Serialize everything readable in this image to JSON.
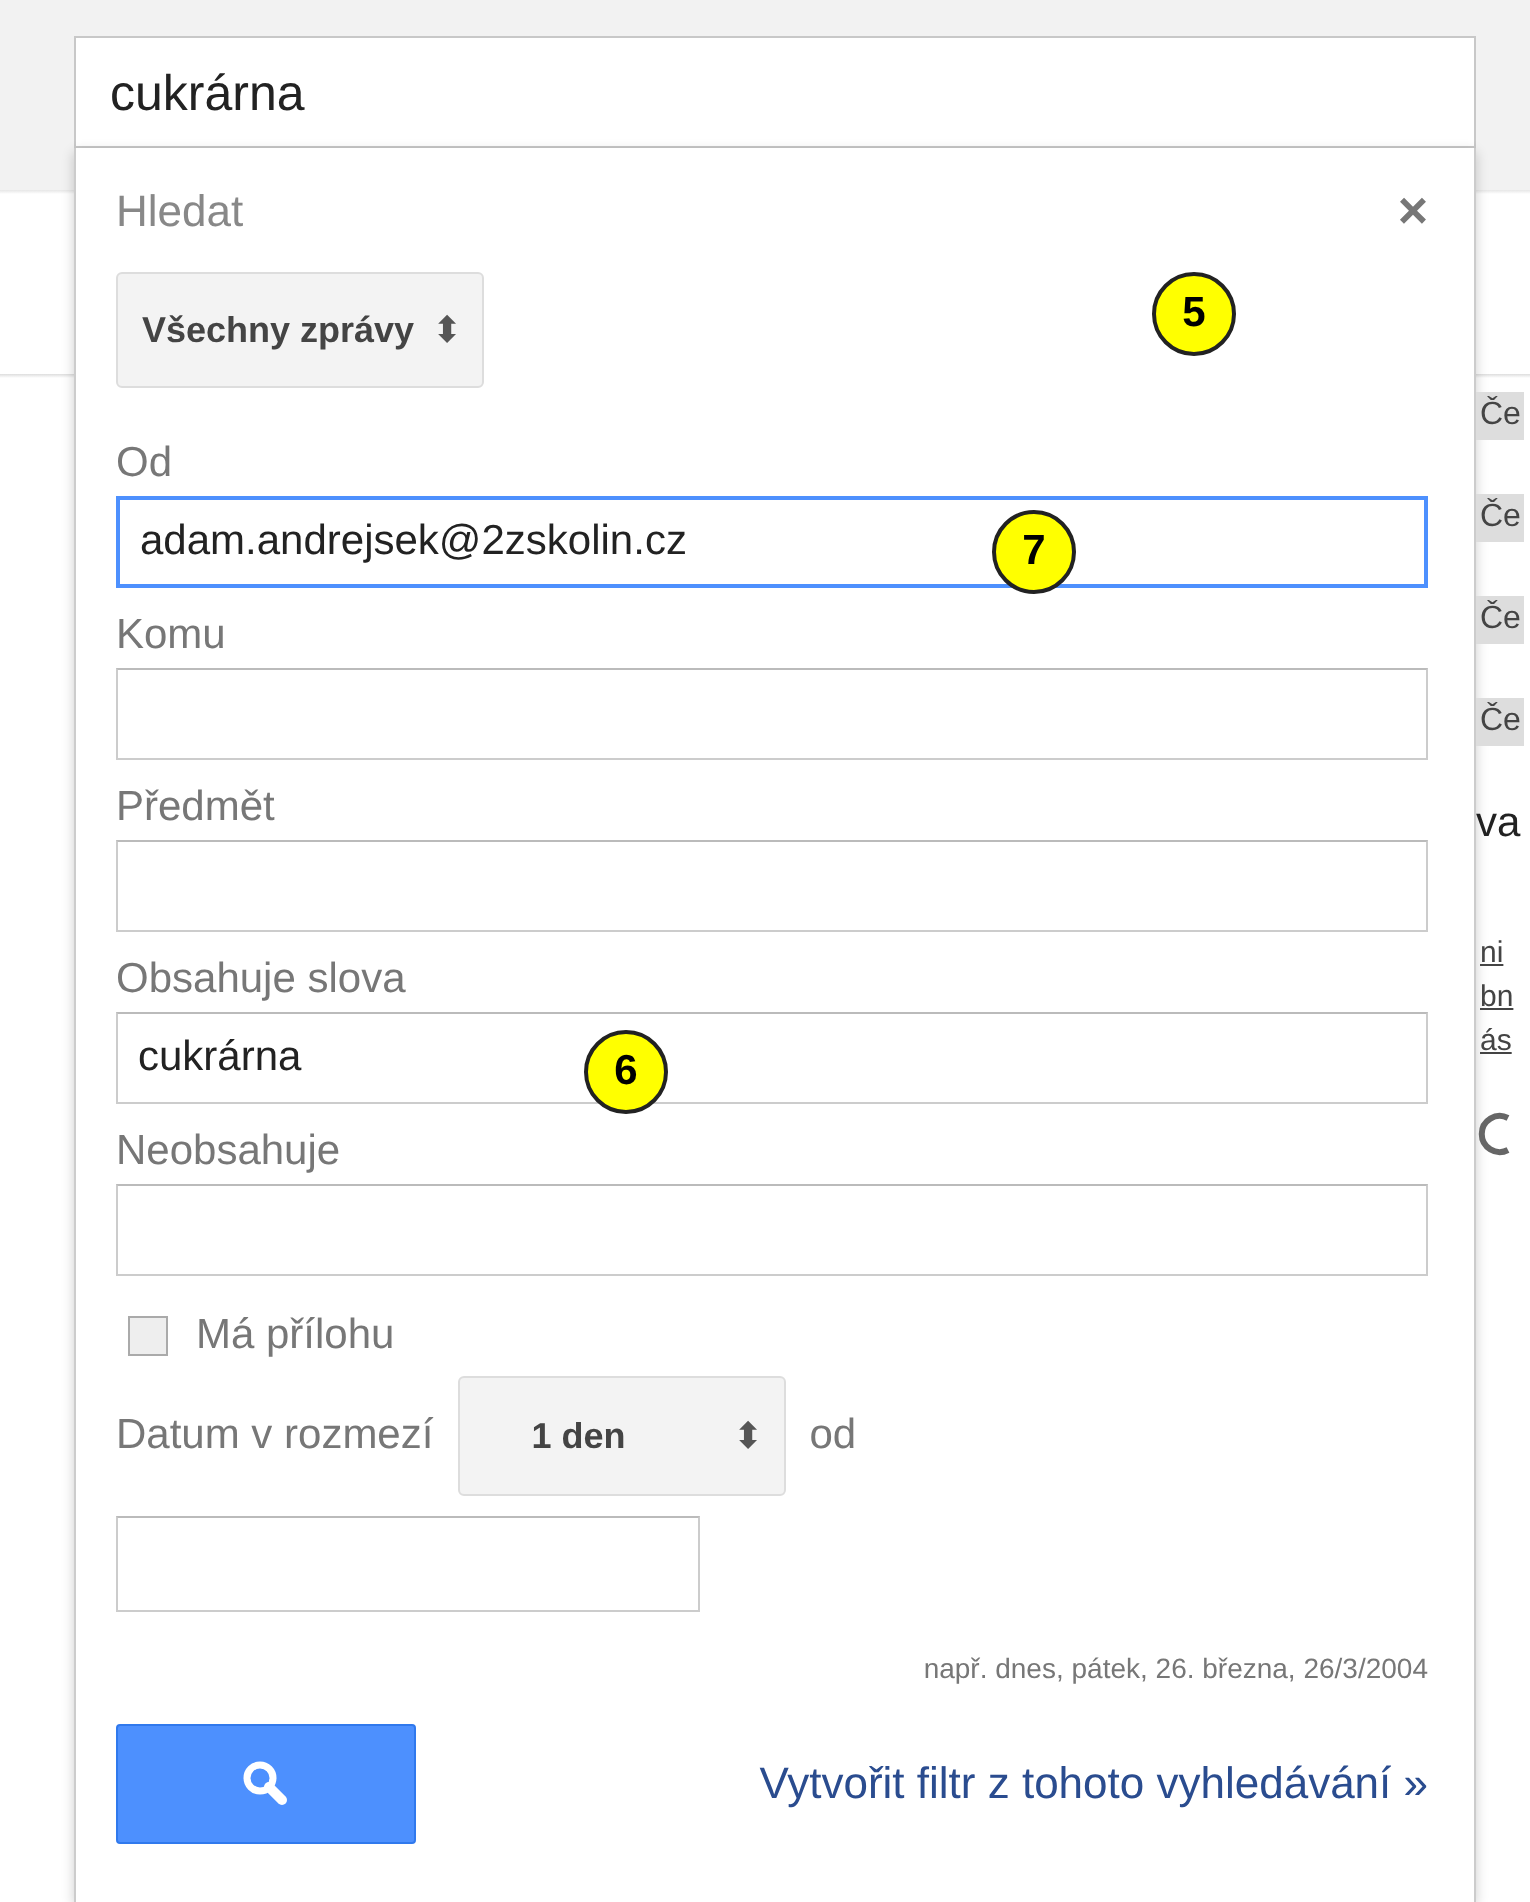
{
  "search_box": {
    "value": "cukrárna"
  },
  "panel": {
    "title": "Hledat",
    "close": "×",
    "scope": {
      "value": "Všechny zprávy",
      "arrows": "⬍"
    }
  },
  "fields": [
    {
      "label": "Od",
      "value": "adam.andrejsek@2zskolin.cz",
      "focused": true
    },
    {
      "label": "Komu",
      "focused": false
    },
    {
      "label": "Předmět",
      "focused": false
    },
    {
      "label": "Obsahuje slova",
      "value": "cukrárna",
      "focused": false
    },
    {
      "label": "Neobsahuje",
      "focused": false
    }
  ],
  "attachment": {
    "label": "Má přílohu",
    "checked": false
  },
  "date_range": {
    "label": "Datum v rozmezí",
    "value": "1 den",
    "arrows": "⬍",
    "suffix": "od",
    "hint": "např. dnes, pátek, 26. března, 26/3/2004"
  },
  "create_filter_link": "Vytvořit filtr z tohoto vyhledávání »",
  "background_fragments": [
    {
      "text": "Če",
      "kind": "chip"
    },
    {
      "text": "Če",
      "kind": "chip"
    },
    {
      "text": "Če",
      "kind": "chip"
    },
    {
      "text": "Če",
      "kind": "chip"
    },
    {
      "text": "va",
      "kind": "text"
    },
    {
      "text": "ni",
      "kind": "link"
    },
    {
      "text": "bn",
      "kind": "link"
    },
    {
      "text": "ás",
      "kind": "link"
    }
  ],
  "annotations": [
    {
      "text": "5"
    },
    {
      "text": "7"
    },
    {
      "text": "6"
    }
  ]
}
